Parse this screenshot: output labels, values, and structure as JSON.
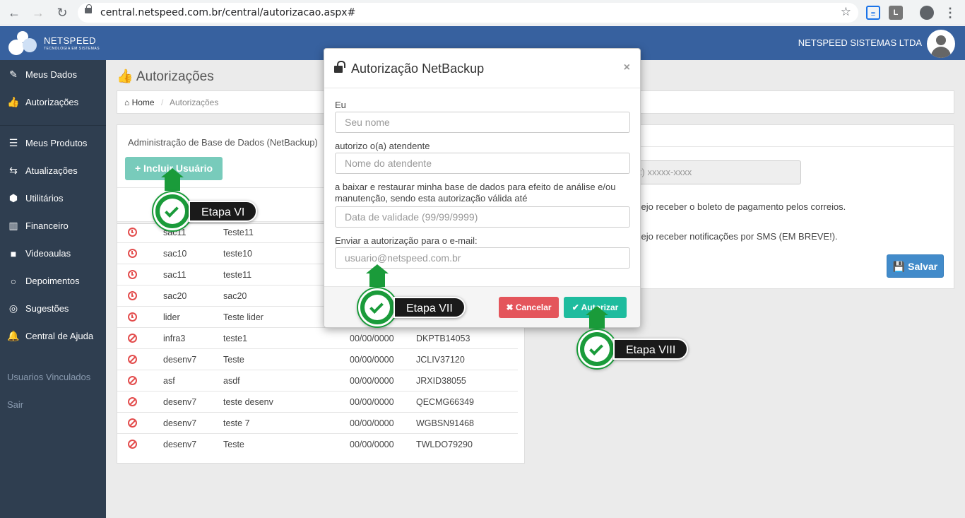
{
  "browser": {
    "url": "central.netspeed.com.br/central/autorizacao.aspx#",
    "ext1": "≡",
    "ext2": "L"
  },
  "header": {
    "logo_name": "NETSPEED",
    "logo_tagline": "TECNOLOGIA EM SISTEMAS",
    "company": "NETSPEED SISTEMAS LTDA"
  },
  "sidebar": {
    "items": [
      {
        "label": "Meus Dados",
        "icon": "edit-icon"
      },
      {
        "label": "Autorizações",
        "icon": "thumbs-up-icon"
      },
      {
        "label": "Meus Produtos",
        "icon": "list-icon"
      },
      {
        "label": "Atualizações",
        "icon": "retweet-icon"
      },
      {
        "label": "Utilitários",
        "icon": "cubes-icon"
      },
      {
        "label": "Financeiro",
        "icon": "bar-chart-icon"
      },
      {
        "label": "Videoaulas",
        "icon": "video-camera-icon"
      },
      {
        "label": "Depoimentos",
        "icon": "comment-icon"
      },
      {
        "label": "Sugestões",
        "icon": "comments-icon"
      },
      {
        "label": "Central de Ajuda",
        "icon": "bell-icon"
      }
    ],
    "usuarios_vinculados": "Usuarios Vinculados",
    "sair": "Sair"
  },
  "page": {
    "title": "Autorizações",
    "breadcrumb_home": "Home",
    "breadcrumb_sep": "/",
    "breadcrumb_current": "Autorizações"
  },
  "left_panel": {
    "heading": "Administração de Base de Dados (NetBackup)",
    "incluir_label": "Incluir Usuário",
    "rows": [
      {
        "status": "clock",
        "user": "sac11",
        "name": "Teste11",
        "date": "",
        "code": ""
      },
      {
        "status": "clock",
        "user": "sac10",
        "name": "teste10",
        "date": "",
        "code": ""
      },
      {
        "status": "clock",
        "user": "sac11",
        "name": "teste11",
        "date": "",
        "code": ""
      },
      {
        "status": "clock",
        "user": "sac20",
        "name": "sac20",
        "date": "",
        "code": ""
      },
      {
        "status": "clock",
        "user": "lider",
        "name": "Teste lider",
        "date": "",
        "code": ""
      },
      {
        "status": "ban",
        "user": "infra3",
        "name": "teste1",
        "date": "00/00/0000",
        "code": "DKPTB14053"
      },
      {
        "status": "ban",
        "user": "desenv7",
        "name": "Teste",
        "date": "00/00/0000",
        "code": "JCLIV37120"
      },
      {
        "status": "ban",
        "user": "asf",
        "name": "asdf",
        "date": "00/00/0000",
        "code": "JRXID38055"
      },
      {
        "status": "ban",
        "user": "desenv7",
        "name": "teste desenv",
        "date": "00/00/0000",
        "code": "QECMG66349"
      },
      {
        "status": "ban",
        "user": "desenv7",
        "name": "teste 7",
        "date": "00/00/0000",
        "code": "WGBSN91468"
      },
      {
        "status": "ban",
        "user": "desenv7",
        "name": "Teste",
        "date": "00/00/0000",
        "code": "TWLDO79290"
      }
    ]
  },
  "right_panel": {
    "phone_placeholder": "x) xxxxx-xxxx",
    "boleto_text": "sejo receber o boleto de pagamento pelos correios.",
    "sms_text": "sejo receber notificações por SMS (EM BREVE!).",
    "salvar_label": "Salvar"
  },
  "modal": {
    "title": "Autorização NetBackup",
    "close": "×",
    "label_eu": "Eu",
    "placeholder_nome": "Seu nome",
    "label_autorizo": "autorizo o(a) atendente",
    "placeholder_atendente": "Nome do atendente",
    "label_baixar": "a baixar e restaurar minha base de dados para efeito de análise e/ou manutenção, sendo esta autorização válida até",
    "placeholder_data": "Data de validade (99/99/9999)",
    "label_email": "Enviar a autorização para o e-mail:",
    "placeholder_email": "usuario@netspeed.com.br",
    "cancelar_label": "Cancelar",
    "autorizar_label": "Autorizar"
  },
  "steps": {
    "etapa6": "Etapa VI",
    "etapa7": "Etapa VII",
    "etapa8": "Etapa VIII"
  },
  "colors": {
    "topbar": "#37619f",
    "sidebar": "#2f3e50",
    "incluir": "#78cbbb",
    "salvar": "#428bca",
    "cancelar": "#e4555b",
    "autorizar": "#1ebc9e",
    "step_green": "#1a9b3a"
  }
}
